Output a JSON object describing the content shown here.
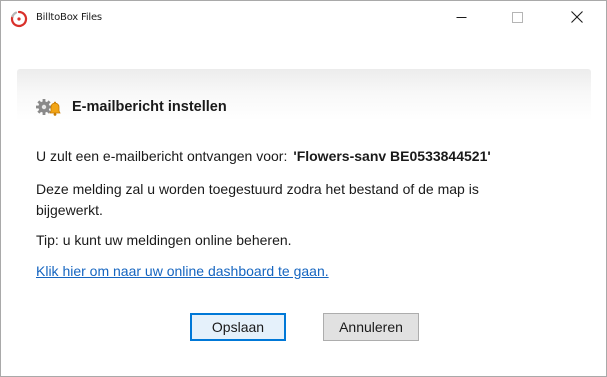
{
  "window": {
    "title": "BilltoBox Files",
    "controls": {
      "minimize_icon": "minimize-icon",
      "maximize_icon": "maximize-icon",
      "close_icon": "close-icon"
    }
  },
  "dialog": {
    "header_icon": "gear-bell-icon",
    "title": "E-mailbericht instellen",
    "message_prefix": "U zult een e-mailbericht ontvangen voor:",
    "message_target": "'Flowers-sanv BE0533844521'",
    "description": "Deze melding zal u worden toegestuurd zodra het bestand of de map is bijgewerkt.",
    "tip": "Tip: u kunt uw meldingen online beheren.",
    "link_label": "Klik hier om naar uw online dashboard te gaan.",
    "save_label": "Opslaan",
    "cancel_label": "Annuleren"
  },
  "colors": {
    "accent": "#0078d7",
    "link": "#1565c0",
    "app_icon_red": "#d9312b"
  }
}
